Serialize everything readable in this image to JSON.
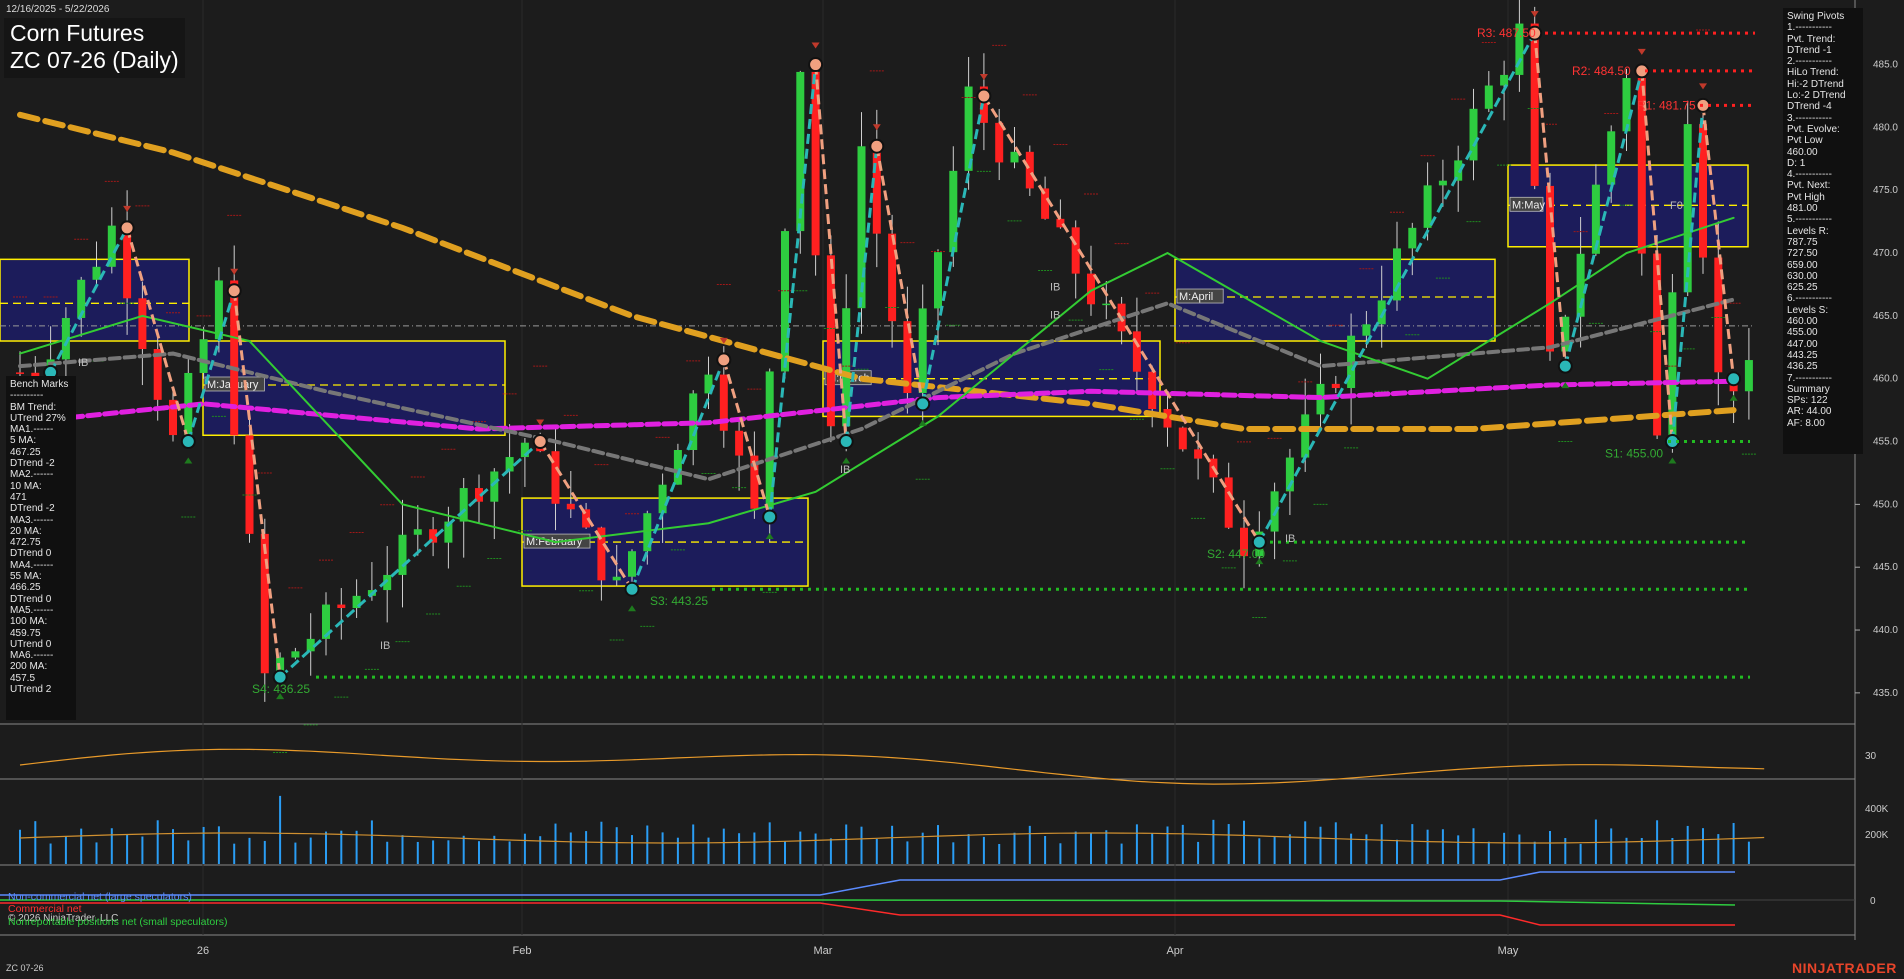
{
  "date_range": "12/16/2025 - 5/22/2026",
  "title": {
    "line1": "Corn Futures",
    "line2": "ZC 07-26 (Daily)"
  },
  "footer_symbol": "ZC 07-26",
  "brand": "NINJATRADER",
  "copyright": "© 2026 NinjaTrader, LLC",
  "colors": {
    "bull": "#2ecc40",
    "bear": "#ff2020",
    "pivot_up": "#2ab7b7",
    "pivot_down": "#f0a080",
    "ma_gold": "#e0a020",
    "ma_magenta": "#e020e0",
    "ma_gray": "#777777",
    "ma_green": "#33cc33",
    "box_fill": "#1c1c66",
    "box_border": "#ffee00"
  },
  "swing_panel": [
    "Swing Pivots",
    "1.-----------",
    "Pvt. Trend:",
    "DTrend -1",
    "2.-----------",
    "HiLo Trend:",
    "Hi:-2 DTrend",
    "Lo:-2 DTrend",
    "DTrend -4",
    "3.-----------",
    "Pvt. Evolve:",
    "Pvt Low",
    "460.00",
    "D: 1",
    "4.-----------",
    "Pvt. Next:",
    "Pvt High",
    "481.00",
    "5.-----------",
    "Levels R:",
    "787.75",
    "727.50",
    "659.00",
    "630.00",
    "625.25",
    "6.-----------",
    "Levels S:",
    "460.00",
    "455.00",
    "447.00",
    "443.25",
    "436.25",
    "7.-----------",
    "Summary",
    "SPs: 122",
    "AR: 44.00",
    "AF: 8.00"
  ],
  "bench_panel": [
    "Bench Marks",
    "----------",
    "BM Trend:",
    "UTrend 27%",
    "MA1.------",
    "5 MA:",
    "467.25",
    "DTrend -2",
    "MA2.------",
    "10 MA:",
    "471",
    "DTrend -2",
    "MA3.------",
    "20 MA:",
    "472.75",
    "DTrend 0",
    "MA4.------",
    "55 MA:",
    "466.25",
    "DTrend 0",
    "MA5.------",
    "100 MA:",
    "459.75",
    "UTrend 0",
    "MA6.------",
    "200 MA:",
    "457.5",
    "UTrend 2"
  ],
  "chart_data": {
    "type": "candlestick",
    "yaxis": {
      "ylim": [
        433,
        489.5
      ],
      "ticks": [
        435,
        440,
        445,
        450,
        455,
        460,
        465,
        470,
        475,
        480,
        485
      ]
    },
    "xaxis": {
      "labels": [
        "26",
        "Feb",
        "Mar",
        "Apr",
        "May"
      ]
    },
    "month_labels": [
      "M:January",
      "M:February",
      "M:March",
      "M:April",
      "M:May"
    ],
    "levels": [
      {
        "label": "R3: 487.50",
        "value": 487.5,
        "kind": "resistance"
      },
      {
        "label": "R2: 484.50",
        "value": 484.5,
        "kind": "resistance"
      },
      {
        "label": "R1: 481.75",
        "value": 481.75,
        "kind": "resistance"
      },
      {
        "label": "S1: 455.00",
        "value": 455.0,
        "kind": "support"
      },
      {
        "label": "S2: 447.00",
        "value": 447.0,
        "kind": "support"
      },
      {
        "label": "S3: 443.25",
        "value": 443.25,
        "kind": "support"
      },
      {
        "label": "S4: 436.25",
        "value": 436.25,
        "kind": "support"
      }
    ],
    "ib_labels": [
      "IB",
      "IB",
      "IB",
      "IB",
      "IB",
      "IB"
    ],
    "f0_label": "F0",
    "pivots": [
      {
        "i": 2,
        "v": 460.5,
        "t": "L"
      },
      {
        "i": 7,
        "v": 472.0,
        "t": "H"
      },
      {
        "i": 11,
        "v": 455.0,
        "t": "L"
      },
      {
        "i": 14,
        "v": 467.0,
        "t": "H"
      },
      {
        "i": 17,
        "v": 436.25,
        "t": "L"
      },
      {
        "i": 34,
        "v": 455.0,
        "t": "H"
      },
      {
        "i": 40,
        "v": 443.25,
        "t": "L"
      },
      {
        "i": 46,
        "v": 461.5,
        "t": "H"
      },
      {
        "i": 49,
        "v": 449.0,
        "t": "L"
      },
      {
        "i": 52,
        "v": 485.0,
        "t": "H"
      },
      {
        "i": 54,
        "v": 455.0,
        "t": "L"
      },
      {
        "i": 56,
        "v": 478.5,
        "t": "H"
      },
      {
        "i": 59,
        "v": 458.0,
        "t": "L"
      },
      {
        "i": 63,
        "v": 482.5,
        "t": "H"
      },
      {
        "i": 81,
        "v": 447.0,
        "t": "L"
      },
      {
        "i": 99,
        "v": 487.5,
        "t": "H"
      },
      {
        "i": 101,
        "v": 461.0,
        "t": "L"
      },
      {
        "i": 106,
        "v": 484.5,
        "t": "H"
      },
      {
        "i": 108,
        "v": 455.0,
        "t": "L"
      },
      {
        "i": 110,
        "v": 481.75,
        "t": "H"
      },
      {
        "i": 112,
        "v": 460.0,
        "t": "L"
      }
    ],
    "moving_averages": [
      {
        "name": "200 MA",
        "points": [
          [
            0,
            481
          ],
          [
            10,
            478
          ],
          [
            25,
            472
          ],
          [
            40,
            465
          ],
          [
            55,
            460
          ],
          [
            70,
            458
          ],
          [
            80,
            456
          ],
          [
            95,
            456
          ],
          [
            112,
            457.5
          ]
        ]
      },
      {
        "name": "100 MA",
        "points": [
          [
            0,
            456.5
          ],
          [
            12,
            458
          ],
          [
            30,
            456
          ],
          [
            45,
            456.5
          ],
          [
            60,
            458.5
          ],
          [
            70,
            459
          ],
          [
            85,
            458.5
          ],
          [
            100,
            459.5
          ],
          [
            112,
            459.8
          ]
        ]
      },
      {
        "name": "55 MA",
        "points": [
          [
            0,
            461
          ],
          [
            10,
            462
          ],
          [
            20,
            459
          ],
          [
            35,
            455
          ],
          [
            45,
            452
          ],
          [
            55,
            456
          ],
          [
            65,
            462
          ],
          [
            75,
            466
          ],
          [
            85,
            461
          ],
          [
            100,
            462.5
          ],
          [
            112,
            466.3
          ]
        ]
      },
      {
        "name": "20 MA",
        "points": [
          [
            0,
            462
          ],
          [
            8,
            465
          ],
          [
            15,
            463
          ],
          [
            25,
            450
          ],
          [
            35,
            447
          ],
          [
            45,
            448.5
          ],
          [
            52,
            451
          ],
          [
            60,
            457
          ],
          [
            70,
            467
          ],
          [
            75,
            470
          ],
          [
            85,
            463
          ],
          [
            92,
            460
          ],
          [
            100,
            466
          ],
          [
            105,
            470
          ],
          [
            112,
            472.8
          ]
        ]
      }
    ],
    "volume_axis": [
      "400K",
      "200K"
    ],
    "indicator_axis": [
      "30"
    ],
    "cot_axis": [
      "0"
    ],
    "cot_legend": [
      "Non-commercial net (large speculators)",
      "Commercial net",
      "Nonreportable positions net (small speculators)"
    ]
  }
}
